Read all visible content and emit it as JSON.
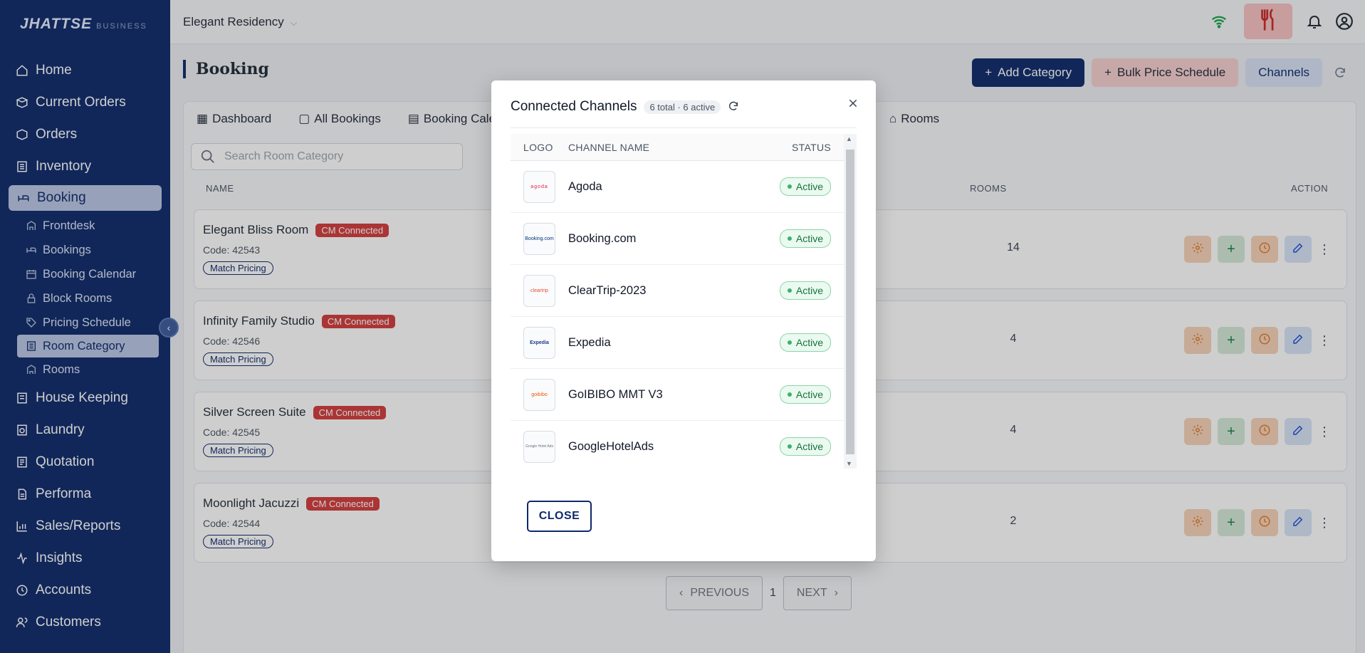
{
  "brand": {
    "name": "JHATTSE",
    "suffix": "BUSINESS"
  },
  "sidebar": {
    "items": [
      {
        "label": "Home",
        "icon": "home-icon"
      },
      {
        "label": "Current Orders",
        "icon": "box-icon"
      },
      {
        "label": "Orders",
        "icon": "package-icon"
      },
      {
        "label": "Inventory",
        "icon": "building-icon"
      },
      {
        "label": "Booking",
        "icon": "bed-icon",
        "active": true
      }
    ],
    "sub_items": [
      {
        "label": "Frontdesk",
        "icon": "desk-icon"
      },
      {
        "label": "Bookings",
        "icon": "bed-icon"
      },
      {
        "label": "Booking Calendar",
        "icon": "calendar-icon"
      },
      {
        "label": "Block Rooms",
        "icon": "lock-icon"
      },
      {
        "label": "Pricing Schedule",
        "icon": "tag-icon"
      },
      {
        "label": "Room Category",
        "icon": "category-icon",
        "active": true
      },
      {
        "label": "Rooms",
        "icon": "building-icon"
      }
    ],
    "bottom_items": [
      {
        "label": "House Keeping",
        "icon": "broom-icon"
      },
      {
        "label": "Laundry",
        "icon": "laundry-icon"
      },
      {
        "label": "Quotation",
        "icon": "quotation-icon"
      },
      {
        "label": "Performa",
        "icon": "document-icon"
      },
      {
        "label": "Sales/Reports",
        "icon": "chart-icon"
      },
      {
        "label": "Insights",
        "icon": "insights-icon"
      },
      {
        "label": "Accounts",
        "icon": "accounts-icon"
      },
      {
        "label": "Customers",
        "icon": "users-icon"
      }
    ]
  },
  "topbar": {
    "property": "Elegant Residency"
  },
  "page": {
    "title": "Booking",
    "add_category": "Add Category",
    "bulk_price": "Bulk Price Schedule",
    "channels": "Channels"
  },
  "tabs": [
    {
      "label": "Dashboard"
    },
    {
      "label": "All Bookings"
    },
    {
      "label": "Booking Calen"
    }
  ],
  "rooms_tab": "Rooms",
  "search": {
    "placeholder": "Search Room Category"
  },
  "columns": {
    "name": "NAME",
    "rooms": "ROOMS",
    "action": "ACTION"
  },
  "rows": [
    {
      "name": "Elegant Bliss Room",
      "badge": "CM Connected",
      "code": "Code: 42543",
      "match": "Match Pricing",
      "rooms": "14"
    },
    {
      "name": "Infinity Family Studio",
      "badge": "CM Connected",
      "code": "Code: 42546",
      "match": "Match Pricing",
      "rooms": "4"
    },
    {
      "name": "Silver Screen Suite",
      "badge": "CM Connected",
      "code": "Code: 42545",
      "match": "Match Pricing",
      "rooms": "4"
    },
    {
      "name": "Moonlight Jacuzzi",
      "badge": "CM Connected",
      "code": "Code: 42544",
      "match": "Match Pricing",
      "rooms": "2"
    }
  ],
  "pager": {
    "previous": "PREVIOUS",
    "page": "1",
    "next": "NEXT"
  },
  "modal": {
    "title": "Connected Channels",
    "count": "6 total · 6 active",
    "headers": {
      "logo": "LOGO",
      "name": "CHANNEL NAME",
      "status": "STATUS"
    },
    "channels": [
      {
        "name": "Agoda",
        "status": "Active",
        "logo_text": "agoda"
      },
      {
        "name": "Booking.com",
        "status": "Active",
        "logo_text": "Booking.com"
      },
      {
        "name": "ClearTrip-2023",
        "status": "Active",
        "logo_text": "cleartrip"
      },
      {
        "name": "Expedia",
        "status": "Active",
        "logo_text": "Expedia"
      },
      {
        "name": "GoIBIBO MMT V3",
        "status": "Active",
        "logo_text": "goibibo"
      },
      {
        "name": "GoogleHotelAds",
        "status": "Active",
        "logo_text": "Google Hotel Ads"
      }
    ],
    "close": "CLOSE"
  },
  "colors": {
    "sidebar": "#0e2a6b",
    "accent": "#0e2a6b",
    "cm_badge": "#d33c3c",
    "active_status": "#16733a"
  }
}
